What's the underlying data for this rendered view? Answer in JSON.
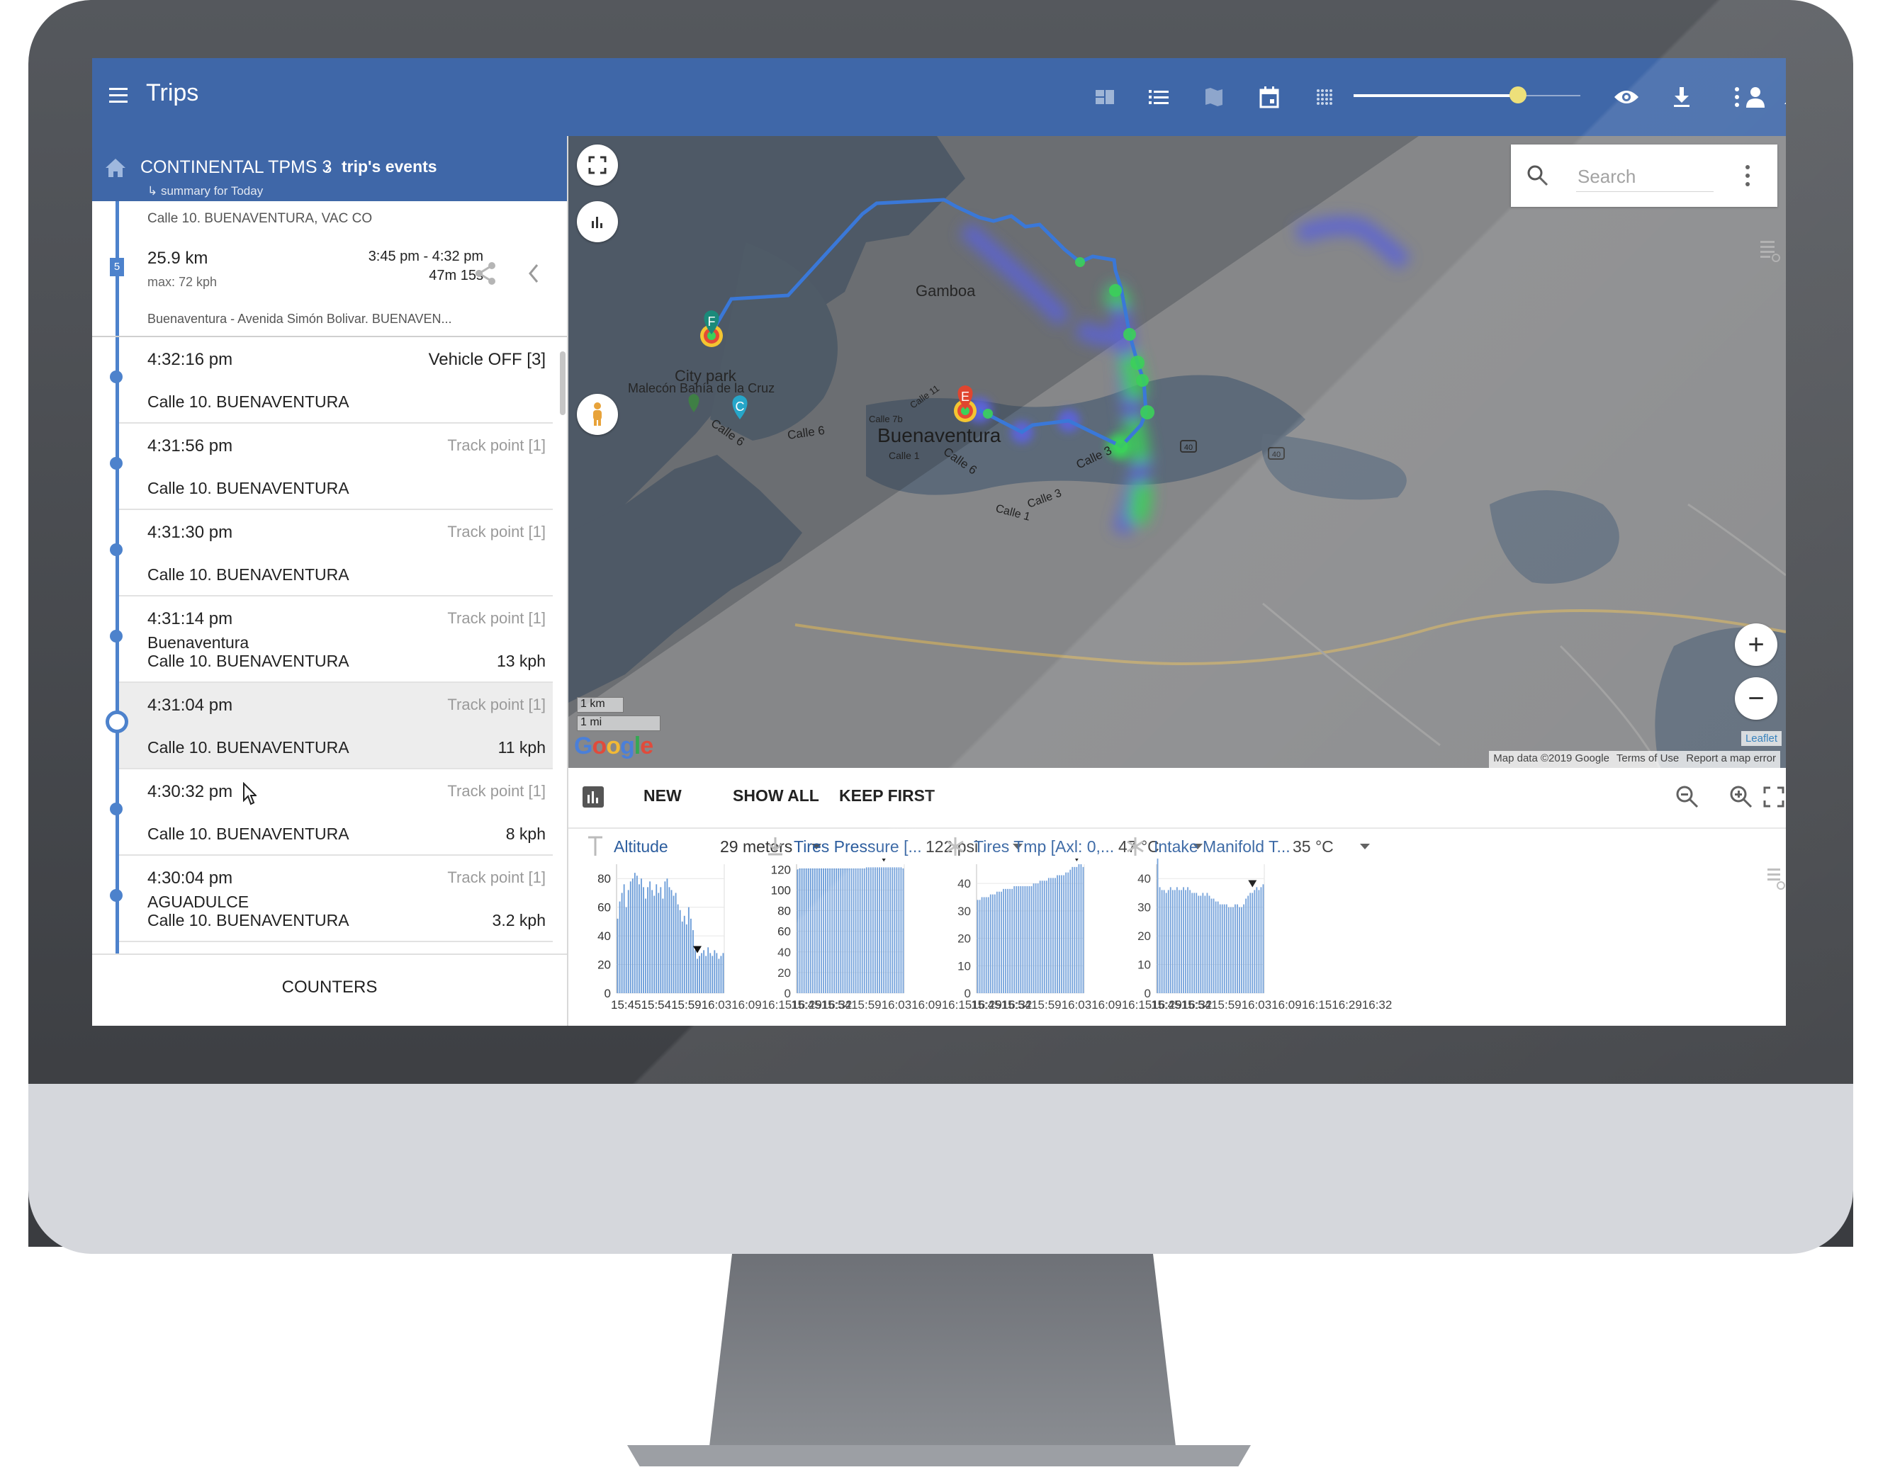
{
  "app": {
    "title": "Trips"
  },
  "toolbar": {
    "icons": [
      "dashboard-icon",
      "list-icon",
      "map-icon",
      "calendar-icon",
      "grid-dots-icon",
      "eye-icon",
      "download-icon",
      "more-vert-icon",
      "bell-icon",
      "account-icon"
    ],
    "slider_level": 0.8
  },
  "breadcrumb": {
    "vehicle": "CONTINENTAL TPMS 3",
    "page": "trip's events",
    "subtitle": "↳ summary for Today"
  },
  "trip": {
    "number": "5",
    "top_address": "Calle 10. BUENAVENTURA, VAC CO",
    "distance": "25.9 km",
    "max_speed": "max: 72 kph",
    "time_range": "3:45 pm - 4:32 pm",
    "duration": "47m 15s",
    "bottom_address": "Buenaventura - Avenida Simón Bolivar. BUENAVEN..."
  },
  "events": [
    {
      "time": "4:32:16 pm",
      "type": "Vehicle OFF [3]",
      "city": "",
      "street": "Calle 10. BUENAVENTURA",
      "speed": ""
    },
    {
      "time": "4:31:56 pm",
      "type": "Track point [1]",
      "city": "",
      "street": "Calle 10. BUENAVENTURA",
      "speed": ""
    },
    {
      "time": "4:31:30 pm",
      "type": "Track point [1]",
      "city": "",
      "street": "Calle 10. BUENAVENTURA",
      "speed": ""
    },
    {
      "time": "4:31:14 pm",
      "type": "Track point [1]",
      "city": "Buenaventura",
      "street": "Calle 10. BUENAVENTURA",
      "speed": "13 kph"
    },
    {
      "time": "4:31:04 pm",
      "type": "Track point [1]",
      "city": "",
      "street": "Calle 10. BUENAVENTURA",
      "speed": "11 kph"
    },
    {
      "time": "4:30:32 pm",
      "type": "Track point [1]",
      "city": "",
      "street": "Calle 10. BUENAVENTURA",
      "speed": "8 kph"
    },
    {
      "time": "4:30:04 pm",
      "type": "Track point [1]",
      "city": "AGUADULCE",
      "street": "Calle 10. BUENAVENTURA",
      "speed": "3.2 kph"
    }
  ],
  "counters": {
    "label": "COUNTERS"
  },
  "map": {
    "search_placeholder": "Search",
    "labels": {
      "gamboa": "Gamboa",
      "city_park": "City park",
      "malecon": "Malecón Bahía de la Cruz",
      "buenaventura": "Buenaventura",
      "calle6_a": "Calle 6",
      "calle6_b": "Calle 6",
      "calle6_c": "Calle 6",
      "calle1": "Calle 1",
      "calle3_a": "Calle 3",
      "calle3_b": "Calle 3",
      "calle1_b": "Calle 1",
      "calle7b": "Calle 7b",
      "calle11": "Calle 11",
      "road40": "40",
      "road40b": "40"
    },
    "markers": {
      "f": "F",
      "c": "C",
      "e": "E"
    },
    "scale": {
      "km": "1 km",
      "mi": "1 mi"
    },
    "attribution": {
      "data": "Map data ©2019 Google",
      "terms": "Terms of Use",
      "report": "Report a map error"
    },
    "leaflet": "Leaflet",
    "zoom_in": "+",
    "zoom_out": "−",
    "colors": {
      "route": "#3a78d8",
      "land": "#848588",
      "water": "#5a6877",
      "heat_green": "#3bd15a"
    }
  },
  "charts_toolbar": {
    "new": "NEW",
    "show_all": "SHOW ALL",
    "keep_first": "KEEP FIRST"
  },
  "charts": [
    {
      "name": "Altitude",
      "value": "29 meters",
      "icon": "altitude-icon",
      "y_ticks": [
        "80",
        "60",
        "40",
        "20",
        "0"
      ],
      "x_ticks": "15:4515:5415:5916:0316:0916:1516:2916:32",
      "ylim": [
        0,
        90
      ],
      "marker_index": 37,
      "values": [
        52,
        64,
        70,
        76,
        60,
        72,
        78,
        80,
        84,
        82,
        76,
        80,
        74,
        66,
        74,
        78,
        72,
        68,
        76,
        70,
        74,
        66,
        78,
        80,
        74,
        72,
        68,
        70,
        62,
        58,
        50,
        54,
        48,
        60,
        52,
        44,
        30,
        24,
        26,
        28,
        30,
        26,
        32,
        28,
        26,
        30,
        28,
        24,
        26,
        28
      ]
    },
    {
      "name": "Tires Pressure [...",
      "value": "122 psi",
      "icon": "tire-pressure-icon",
      "y_ticks": [
        "120",
        "100",
        "80",
        "60",
        "40",
        "20",
        "0"
      ],
      "x_ticks": "15:4515:5415:5916:0316:0916:1516:2916:32",
      "ylim": [
        0,
        125
      ],
      "marker_index": 40,
      "values": [
        120,
        121,
        121,
        121,
        121,
        121,
        121,
        121,
        121,
        121,
        121,
        121,
        121,
        121,
        121,
        121,
        121,
        121,
        121,
        121,
        121,
        121,
        121,
        121,
        121,
        121,
        121,
        121,
        121,
        121,
        121,
        121,
        122,
        122,
        122,
        122,
        122,
        122,
        122,
        122,
        122,
        122,
        122,
        122,
        122,
        122,
        122,
        122,
        122,
        121
      ]
    },
    {
      "name": "Tires Tmp [Axl: 0,...",
      "value": "47 °C",
      "icon": "snowflake-icon",
      "y_ticks": [
        "40",
        "30",
        "20",
        "10",
        "0"
      ],
      "x_ticks": "15:4515:5415:5916:0316:0916:1516:2916:32",
      "ylim": [
        0,
        47
      ],
      "marker_index": 46,
      "values": [
        34,
        34,
        35,
        35,
        35,
        35,
        36,
        36,
        36,
        37,
        37,
        37,
        38,
        38,
        38,
        38,
        38,
        39,
        39,
        39,
        39,
        39,
        39,
        39,
        39,
        39,
        40,
        40,
        40,
        41,
        41,
        41,
        41,
        42,
        42,
        42,
        42,
        43,
        43,
        43,
        43,
        44,
        44,
        45,
        46,
        46,
        46,
        47,
        47,
        46
      ]
    },
    {
      "name": "Intake Manifold T...",
      "value": "35 °C",
      "icon": "snowflake-icon",
      "y_ticks": [
        "40",
        "30",
        "20",
        "10",
        "0"
      ],
      "x_ticks": "15:4515:5415:5916:0316:0916:1516:2916:32",
      "ylim": [
        0,
        45
      ],
      "marker_index": 44,
      "values": [
        48,
        37,
        36,
        36,
        35,
        36,
        37,
        36,
        36,
        37,
        36,
        36,
        37,
        36,
        37,
        36,
        35,
        35,
        35,
        34,
        34,
        35,
        34,
        35,
        34,
        33,
        33,
        32,
        32,
        31,
        31,
        31,
        31,
        30,
        30,
        30,
        31,
        31,
        30,
        30,
        31,
        33,
        34,
        35,
        35,
        36,
        37,
        36,
        37,
        38
      ]
    }
  ]
}
